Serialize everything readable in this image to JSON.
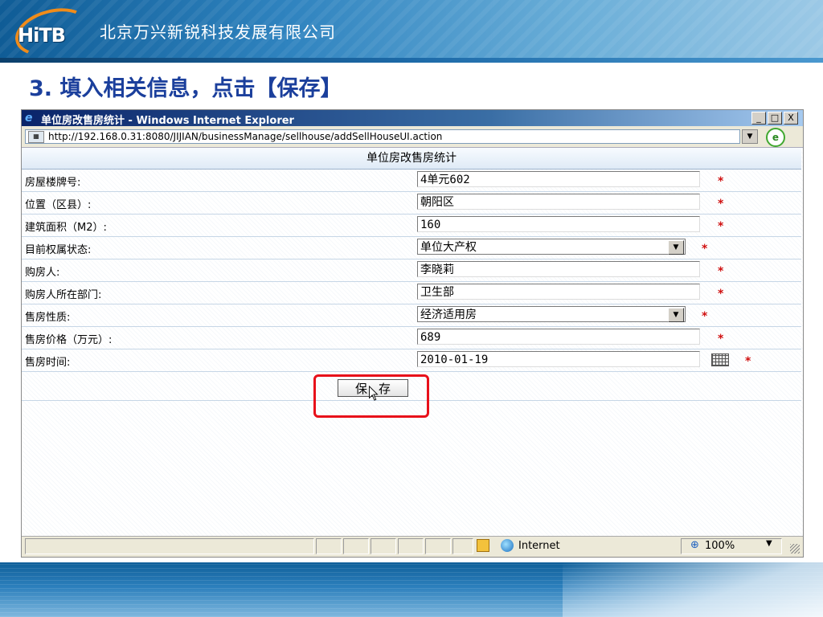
{
  "slide": {
    "logo_text": "HiTB",
    "company": "北京万兴新锐科技发展有限公司",
    "title": "3. 填入相关信息，点击【保存】"
  },
  "window": {
    "title": "单位房改售房统计 - Windows Internet Explorer",
    "controls": [
      "_",
      "□",
      "X"
    ],
    "address_url": "http://192.168.0.31:8080/JIJIAN/businessManage/sellhouse/addSellHouseUI.action"
  },
  "form": {
    "header": "单位房改售房统计",
    "fields": [
      {
        "label": "房屋楼牌号:",
        "value": "4单元602",
        "type": "text"
      },
      {
        "label": "位置（区县）:",
        "value": "朝阳区",
        "type": "text"
      },
      {
        "label": "建筑面积（M2）:",
        "value": "160",
        "type": "text"
      },
      {
        "label": "目前权属状态:",
        "value": "单位大产权",
        "type": "select"
      },
      {
        "label": "购房人:",
        "value": "李晓莉",
        "type": "text"
      },
      {
        "label": "购房人所在部门:",
        "value": "卫生部",
        "type": "text"
      },
      {
        "label": "售房性质:",
        "value": "经济适用房",
        "type": "select"
      },
      {
        "label": "售房价格（万元）:",
        "value": "689",
        "type": "text"
      },
      {
        "label": "售房时间:",
        "value": "2010-01-19",
        "type": "date"
      }
    ],
    "required_mark": "*",
    "save_label": "保存"
  },
  "statusbar": {
    "zone": "Internet",
    "zoom": "100%"
  },
  "colors": {
    "slide_title": "#1b3f9c",
    "highlight": "#e8101a",
    "required": "#d01010"
  }
}
